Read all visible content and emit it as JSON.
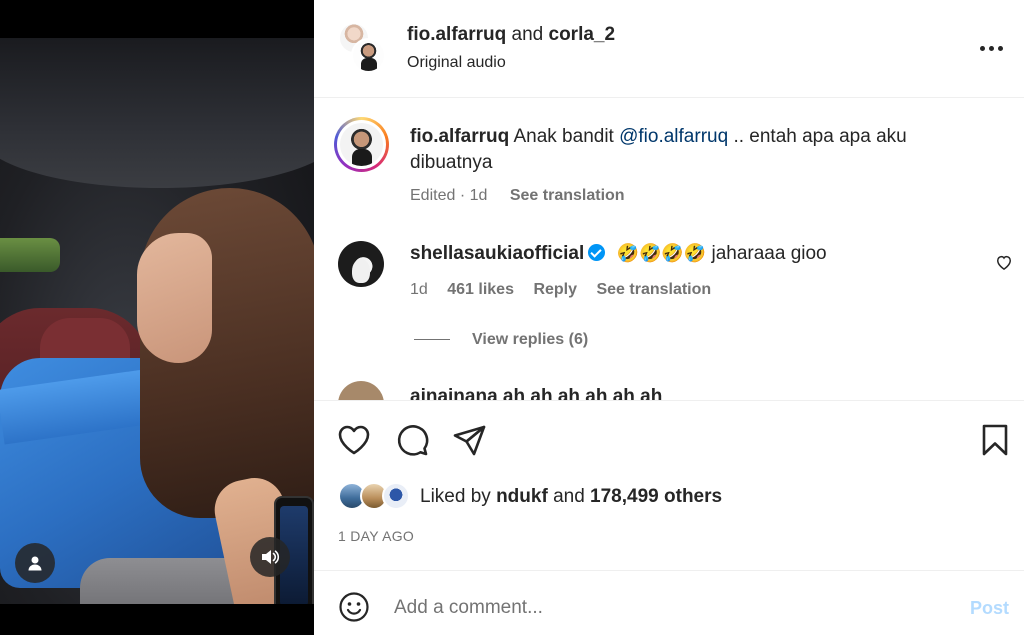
{
  "header": {
    "user_a": "fio.alfarruq",
    "conjunction": "and",
    "user_b": "corla_2",
    "audio": "Original audio",
    "more_icon": "more-horizontal-icon"
  },
  "caption": {
    "username": "fio.alfarruq",
    "text_before": "Anak bandit",
    "mention": "@fio.alfarruq",
    "text_after": ".. entah apa apa aku dibuatnya",
    "edited": "Edited",
    "separator": "·",
    "time": "1d",
    "see_translation": "See translation"
  },
  "comment": {
    "username": "shellasaukiaofficial",
    "emojis": "🤣🤣🤣🤣",
    "text": "jaharaaa gioo",
    "time": "1d",
    "likes": "461 likes",
    "reply": "Reply",
    "see_translation": "See translation",
    "view_replies": "View replies (6)"
  },
  "next_comment": {
    "text": "ainainana  ah ah ah ah ah ah"
  },
  "actions": {
    "like_icon": "heart-icon",
    "comment_icon": "comment-icon",
    "share_icon": "share-icon",
    "save_icon": "bookmark-icon"
  },
  "likes": {
    "prefix": "Liked by",
    "user": "ndukf",
    "conjunction": "and",
    "count": "178,499 others"
  },
  "time_ago": "1 DAY AGO",
  "comment_box": {
    "placeholder": "Add a comment...",
    "post_label": "Post"
  },
  "colors": {
    "accent": "#0095f6",
    "post_disabled": "#b3dbff",
    "mention": "#00376b",
    "secondary_text": "#737373"
  }
}
